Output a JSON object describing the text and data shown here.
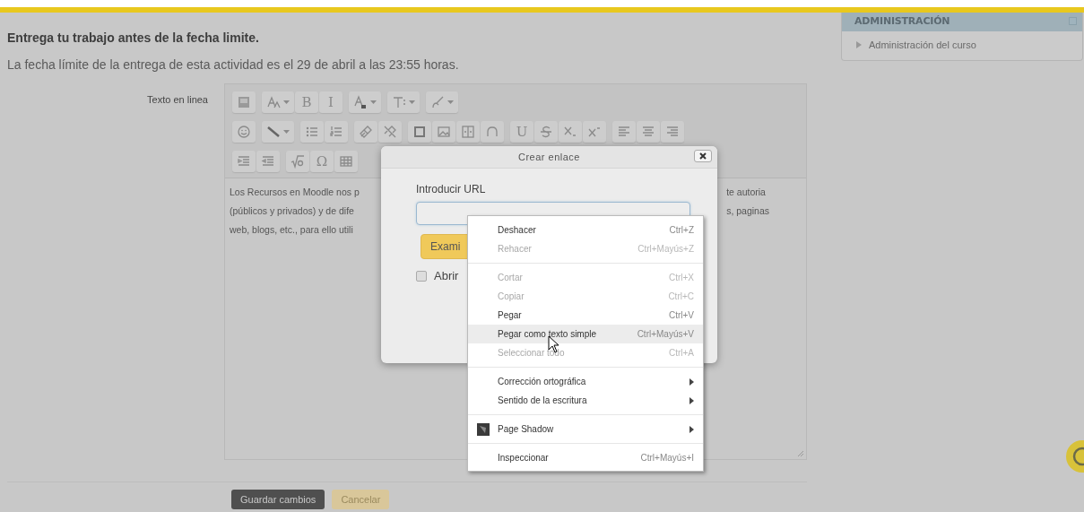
{
  "page": {
    "heading": "Entrega tu trabajo antes de la fecha limite.",
    "deadline": "La fecha límite de la entrega de esta actividad es el 29 de abril a las 23:55 horas."
  },
  "editor": {
    "label": "Texto en linea",
    "toolbar": [
      [
        [
          {
            "kind": "icon"
          }
        ],
        [
          {
            "kind": "dropdown"
          },
          {
            "kind": "text",
            "label": "B"
          },
          {
            "kind": "text",
            "label": "I"
          }
        ],
        [
          {
            "kind": "dropdown"
          }
        ],
        [
          {
            "kind": "dropdown"
          }
        ],
        [
          {
            "kind": "dropdown"
          }
        ]
      ],
      [
        [
          {
            "kind": "icon"
          }
        ],
        [
          {
            "kind": "dropdown"
          }
        ],
        [
          {
            "kind": "icon"
          },
          {
            "kind": "icon"
          }
        ],
        [
          {
            "kind": "icon"
          },
          {
            "kind": "icon"
          }
        ],
        [
          {
            "kind": "icon"
          },
          {
            "kind": "icon"
          },
          {
            "kind": "icon"
          },
          {
            "kind": "icon"
          }
        ],
        [
          {
            "kind": "text",
            "label": "U"
          },
          {
            "kind": "icon"
          },
          {
            "kind": "icon"
          },
          {
            "kind": "icon"
          }
        ],
        [
          {
            "kind": "icon"
          },
          {
            "kind": "icon"
          },
          {
            "kind": "icon"
          }
        ]
      ],
      [
        [
          {
            "kind": "icon"
          },
          {
            "kind": "icon"
          }
        ],
        [
          {
            "kind": "icon"
          },
          {
            "kind": "text",
            "label": "Ω"
          },
          {
            "kind": "icon"
          }
        ]
      ]
    ],
    "content_left": [
      "Los Recursos en Moodle nos p",
      "(públicos y privados) y de dife",
      "web, blogs, etc., para ello utili"
    ],
    "content_right": [
      "te autoria",
      "s, paginas"
    ]
  },
  "dialog": {
    "title": "Crear enlace",
    "url_label": "Introducir URL",
    "browse_button": "Exami",
    "checkbox": {
      "label": "Abrir",
      "checked": false
    }
  },
  "context_menu": {
    "items": [
      {
        "kind": "item",
        "label": "Deshacer",
        "shortcut": "Ctrl+Z",
        "disabled": false,
        "selected": false
      },
      {
        "kind": "item",
        "label": "Rehacer",
        "shortcut": "Ctrl+Mayús+Z",
        "disabled": true,
        "selected": false
      },
      {
        "kind": "separator"
      },
      {
        "kind": "item",
        "label": "Cortar",
        "shortcut": "Ctrl+X",
        "disabled": true,
        "selected": false
      },
      {
        "kind": "item",
        "label": "Copiar",
        "shortcut": "Ctrl+C",
        "disabled": true,
        "selected": false
      },
      {
        "kind": "item",
        "label": "Pegar",
        "shortcut": "Ctrl+V",
        "disabled": false,
        "selected": false
      },
      {
        "kind": "item",
        "label": "Pegar como texto simple",
        "shortcut": "Ctrl+Mayús+V",
        "disabled": false,
        "selected": true
      },
      {
        "kind": "item",
        "label": "Seleccionar todo",
        "shortcut": "Ctrl+A",
        "disabled": true,
        "selected": false
      },
      {
        "kind": "separator"
      },
      {
        "kind": "submenu",
        "label": "Corrección ortográfica",
        "disabled": false,
        "selected": false
      },
      {
        "kind": "submenu",
        "label": "Sentido de la escritura",
        "disabled": false,
        "selected": false
      },
      {
        "kind": "separator"
      },
      {
        "kind": "extension",
        "label": "Page Shadow",
        "disabled": false,
        "selected": false
      },
      {
        "kind": "separator"
      },
      {
        "kind": "item",
        "label": "Inspeccionar",
        "shortcut": "Ctrl+Mayús+I",
        "disabled": false,
        "selected": false
      }
    ]
  },
  "form_buttons": [
    {
      "kind": "primary",
      "label": "Guardar cambios"
    },
    {
      "kind": "secondary",
      "label": "Cancelar"
    }
  ],
  "sidebar": {
    "title": "ADMINISTRACIÓN",
    "items": [
      {
        "label": "Administración del curso",
        "expanded": false
      }
    ]
  }
}
